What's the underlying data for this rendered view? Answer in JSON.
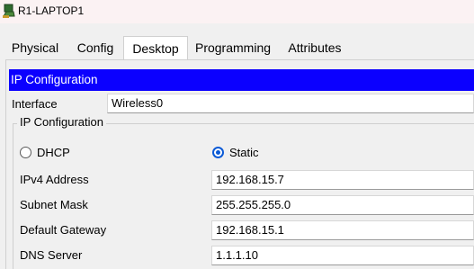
{
  "window": {
    "title": "R1-LAPTOP1"
  },
  "tabs": [
    {
      "label": "Physical"
    },
    {
      "label": "Config"
    },
    {
      "label": "Desktop",
      "active": true
    },
    {
      "label": "Programming"
    },
    {
      "label": "Attributes"
    }
  ],
  "section": {
    "title": "IP Configuration"
  },
  "interface": {
    "label": "Interface",
    "value": "Wireless0"
  },
  "ipconfig": {
    "group_title": "IP Configuration",
    "dhcp_label": "DHCP",
    "static_label": "Static",
    "selected_mode": "Static",
    "ipv4": {
      "label": "IPv4 Address",
      "value": "192.168.15.7"
    },
    "subnet": {
      "label": "Subnet Mask",
      "value": "255.255.255.0"
    },
    "gateway": {
      "label": "Default Gateway",
      "value": "192.168.15.1"
    },
    "dns": {
      "label": "DNS Server",
      "value": "1.1.1.10"
    }
  },
  "colors": {
    "header_bg": "#0b00ff",
    "active_tab_underline": "#1f3a5f",
    "radio_selected": "#0a5ad6"
  }
}
